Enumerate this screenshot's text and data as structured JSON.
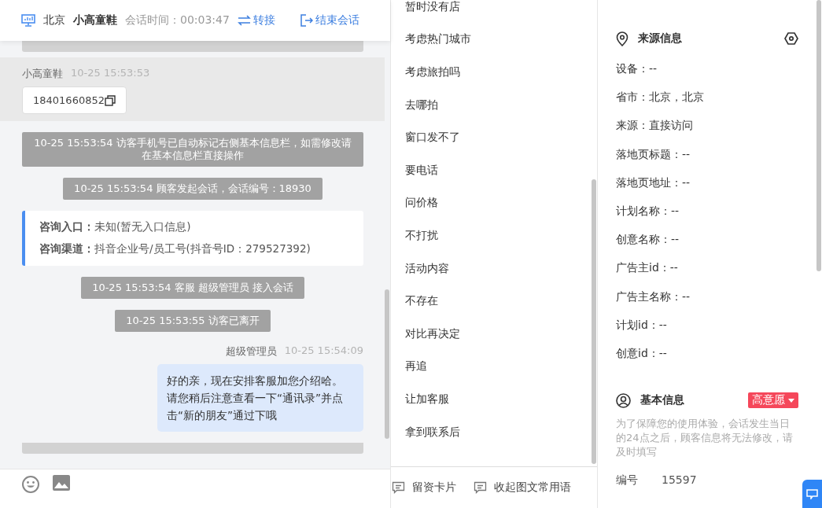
{
  "header": {
    "location": "北京",
    "visitor": "小高童鞋",
    "duration_label": "会话时间：",
    "duration": "00:03:47",
    "transfer": "转接",
    "end": "结束会话"
  },
  "messages": [
    {
      "kind": "cut"
    },
    {
      "kind": "visitor",
      "sender": "小高童鞋",
      "time": "10-25 15:53:53",
      "text": "18401660852"
    },
    {
      "kind": "system",
      "text": "10-25 15:53:54 访客手机号已自动标记右侧基本信息栏，如需修改请在基本信息栏直接操作"
    },
    {
      "kind": "system",
      "text": "10-25 15:53:54 顾客发起会话，会话编号：18930"
    },
    {
      "kind": "info",
      "rows": [
        {
          "label": "咨询入口：",
          "value": "未知(暂无入口信息)"
        },
        {
          "label": "咨询渠道：",
          "value": "抖音企业号/员工号(抖音号ID：279527392)"
        }
      ]
    },
    {
      "kind": "system",
      "text": "10-25 15:53:54 客服 超级管理员 接入会话"
    },
    {
      "kind": "system",
      "text": "10-25 15:53:55 访客已离开"
    },
    {
      "kind": "agent",
      "sender": "超级管理员",
      "time": "10-25 15:54:09",
      "text": "好的亲，现在安排客服加您介绍哈。请您稍后注意查看一下“通讯录”并点击“新的朋友”通过下哦"
    },
    {
      "kind": "cut"
    }
  ],
  "phrases": [
    "暂时没有店",
    "考虑热门城市",
    "考虑旅拍吗",
    "去哪拍",
    "窗口发不了",
    "要电话",
    "问价格",
    "不打扰",
    "活动内容",
    "不存在",
    "对比再决定",
    "再追",
    "让加客服",
    "拿到联系后"
  ],
  "phrase_actions": [
    "留资卡片",
    "收起图文常用语"
  ],
  "source_info": {
    "title": "来源信息",
    "fields": [
      "设备：--",
      "省市：北京，北京",
      "来源：直接访问",
      "落地页标题：--",
      "落地页地址：--",
      "计划名称：--",
      "创意名称：--",
      "广告主id：--",
      "广告主名称：--",
      "计划id：--",
      "创意id：--"
    ]
  },
  "basic_info": {
    "title": "基本信息",
    "tag": "高意愿",
    "notice": "为了保障您的使用体验，会话发生当日的24点之后，顾客信息将无法修改，请及时填写",
    "fields": [
      {
        "label": "编号",
        "value": "15597"
      }
    ]
  }
}
